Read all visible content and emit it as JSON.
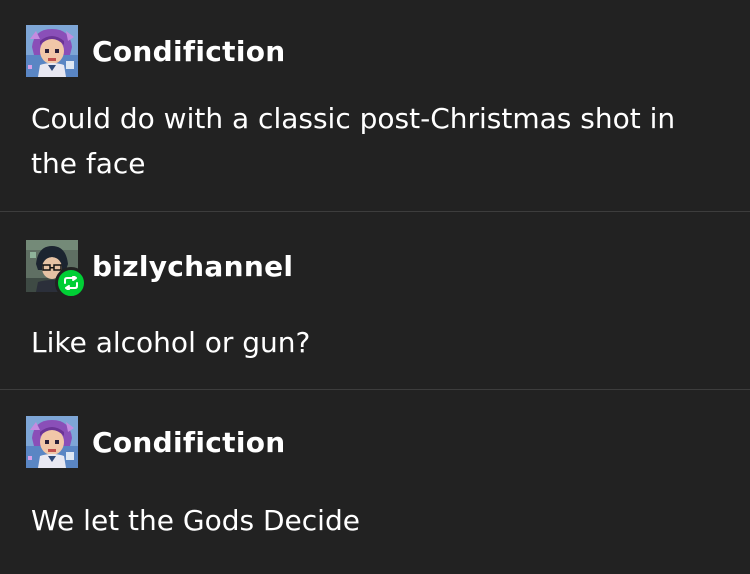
{
  "posts": [
    {
      "username": "Condifiction",
      "avatar_icon": "pixel-art-avatar-purple-hair",
      "text": "Could do with a classic post-Christmas shot in the face"
    },
    {
      "username": "bizlychannel",
      "avatar_icon": "pixel-art-avatar-dark-hair-glasses",
      "badge_icon": "reblog-icon",
      "text": "Like alcohol or gun?"
    },
    {
      "username": "Condifiction",
      "avatar_icon": "pixel-art-avatar-purple-hair",
      "text": "We let the Gods Decide"
    }
  ],
  "colors": {
    "background": "#222222",
    "divider": "#3d3d3d",
    "text": "#ffffff",
    "reblog_badge": "#00cf35"
  }
}
